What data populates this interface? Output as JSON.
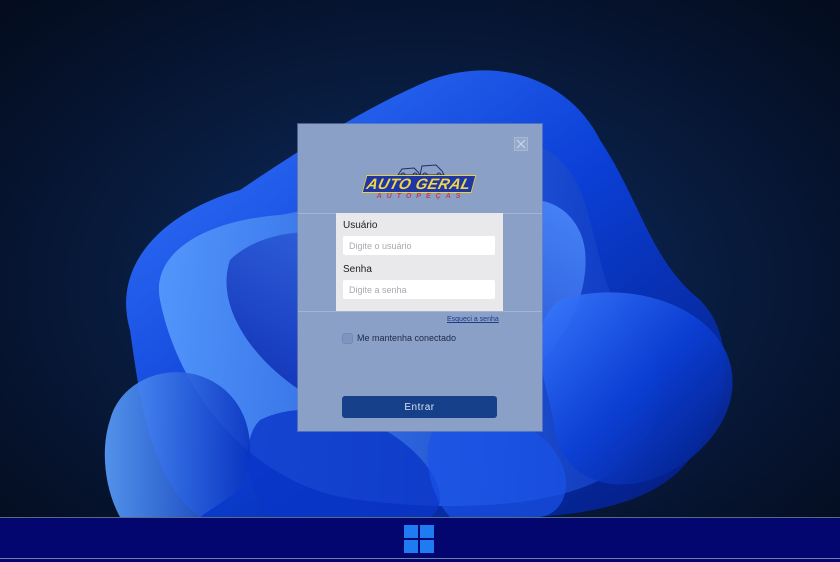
{
  "login": {
    "logo": {
      "brand": "AUTO GERAL",
      "tagline": "AUTOPEÇAS"
    },
    "username": {
      "label": "Usuário",
      "placeholder": "Digite o usuário",
      "value": ""
    },
    "password": {
      "label": "Senha",
      "placeholder": "Digite a senha",
      "value": ""
    },
    "forgot_password": "Esqueci a senha",
    "remember_me": {
      "label": "Me mantenha conectado",
      "checked": false
    },
    "submit_label": "Entrar"
  },
  "icons": {
    "close": "close-icon",
    "start": "windows-logo-icon"
  },
  "colors": {
    "dialog_bg": "#8aa0c6",
    "button_bg": "#16408a",
    "taskbar_bg": "#03066f",
    "brand_yellow": "#f0d64a",
    "brand_blue": "#2036a3",
    "brand_red": "#c23b5a"
  }
}
